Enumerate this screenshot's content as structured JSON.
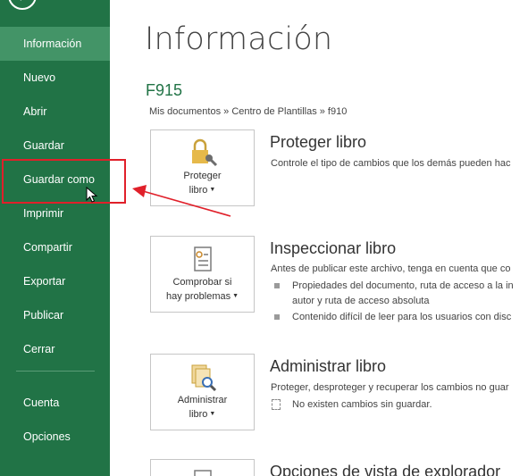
{
  "sidebar": {
    "items": [
      {
        "label": "Información",
        "active": true
      },
      {
        "label": "Nuevo"
      },
      {
        "label": "Abrir"
      },
      {
        "label": "Guardar"
      },
      {
        "label": "Guardar como"
      },
      {
        "label": "Imprimir"
      },
      {
        "label": "Compartir"
      },
      {
        "label": "Exportar"
      },
      {
        "label": "Publicar"
      },
      {
        "label": "Cerrar"
      },
      {
        "label": "Cuenta"
      },
      {
        "label": "Opciones"
      }
    ]
  },
  "main": {
    "title": "Información",
    "file_name": "F915",
    "file_path": "Mis documentos » Centro de Plantillas » f910",
    "sections": [
      {
        "tile_line1": "Proteger",
        "tile_line2": "libro",
        "title": "Proteger libro",
        "desc": "Controle el tipo de cambios que los demás pueden hac"
      },
      {
        "tile_line1": "Comprobar si",
        "tile_line2": "hay problemas",
        "title": "Inspeccionar libro",
        "desc": "Antes de publicar este archivo, tenga en cuenta que co",
        "bullets": [
          "Propiedades del documento, ruta de acceso a la in",
          "autor y ruta de acceso absoluta",
          "Contenido difícil de leer para los usuarios con disc"
        ]
      },
      {
        "tile_line1": "Administrar",
        "tile_line2": "libro",
        "title": "Administrar libro",
        "desc": "Proteger, desproteger y recuperar los cambios no guar",
        "note": "No existen cambios sin guardar."
      },
      {
        "title": "Opciones de vista de explorador"
      }
    ]
  },
  "colors": {
    "sidebar_bg": "#217346",
    "sidebar_active": "#439467",
    "accent_green": "#217346",
    "annotation_red": "#e0202a"
  }
}
